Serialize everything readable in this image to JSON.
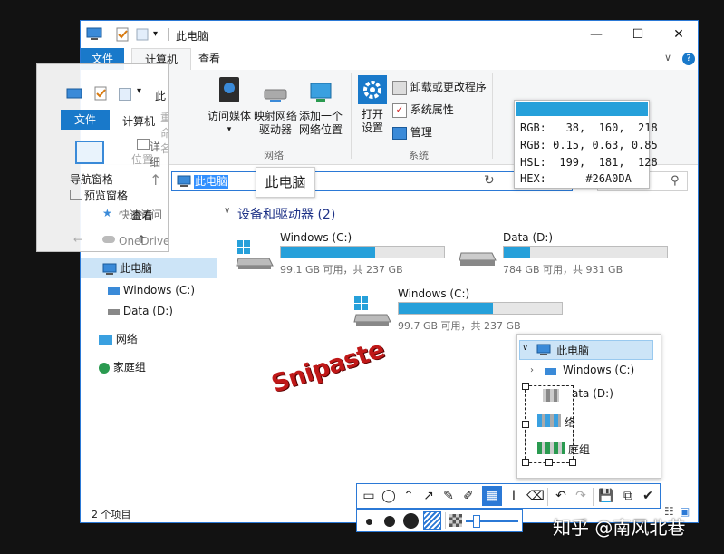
{
  "window": {
    "title": "此电脑",
    "tabs": {
      "file": "文件",
      "computer": "计算机",
      "view": "查看"
    },
    "ribbon": {
      "media": "访问媒体",
      "map_drive_1": "映射网络",
      "map_drive_2": "驱动器",
      "add_location_1": "添加一个",
      "add_location_2": "网络位置",
      "network_group": "网络",
      "open_settings_1": "打开",
      "open_settings_2": "设置",
      "uninstall": "卸载或更改程序",
      "system_props": "系统属性",
      "manage": "管理",
      "system_group": "系统"
    },
    "address": "此电脑",
    "nav": {
      "this_pc": "此电脑",
      "windows_c": "Windows (C:)",
      "data_d": "Data (D:)",
      "network": "网络",
      "homegroup": "家庭组"
    },
    "section_title": "设备和驱动器 (2)",
    "drives": [
      {
        "name": "Windows (C:)",
        "free": "99.1 GB 可用，共 237 GB",
        "used_fraction": 0.58
      },
      {
        "name": "Data (D:)",
        "free": "784 GB 可用，共 931 GB",
        "used_fraction": 0.16
      },
      {
        "name": "Windows (C:)",
        "free": "99.7 GB 可用，共 237 GB",
        "used_fraction": 0.58
      }
    ],
    "status": "2 个项目"
  },
  "ghost": {
    "file_tab": "文件",
    "computer_tab": "计算机",
    "title_part": "此",
    "rename": "重命名",
    "location": "位置",
    "details": "详细",
    "nav_pane": "导航窗格",
    "preview_pane": "预览窗格",
    "quick_access": "快速访问",
    "onedrive": "OneDrive",
    "view_label": "查看"
  },
  "tooltip": "此电脑",
  "picker": {
    "color": "#26A0DA",
    "rgb": "RGB:   38,  160,  218",
    "rgbf": "RGB: 0.15, 0.63, 0.85",
    "hsl": "HSL:  199,  181,  128",
    "hex": "HEX:      #26A0DA"
  },
  "snip": {
    "this_pc": "此电脑",
    "windows_c": "Windows (C:)",
    "data_d": "ata (D:)",
    "network_part": "络",
    "homegroup_part": "庭组"
  },
  "logo": "Snipaste",
  "watermark": "知乎 @南风北巷",
  "colors": {
    "accent": "#26a0da",
    "window_border": "#2b79d6"
  }
}
